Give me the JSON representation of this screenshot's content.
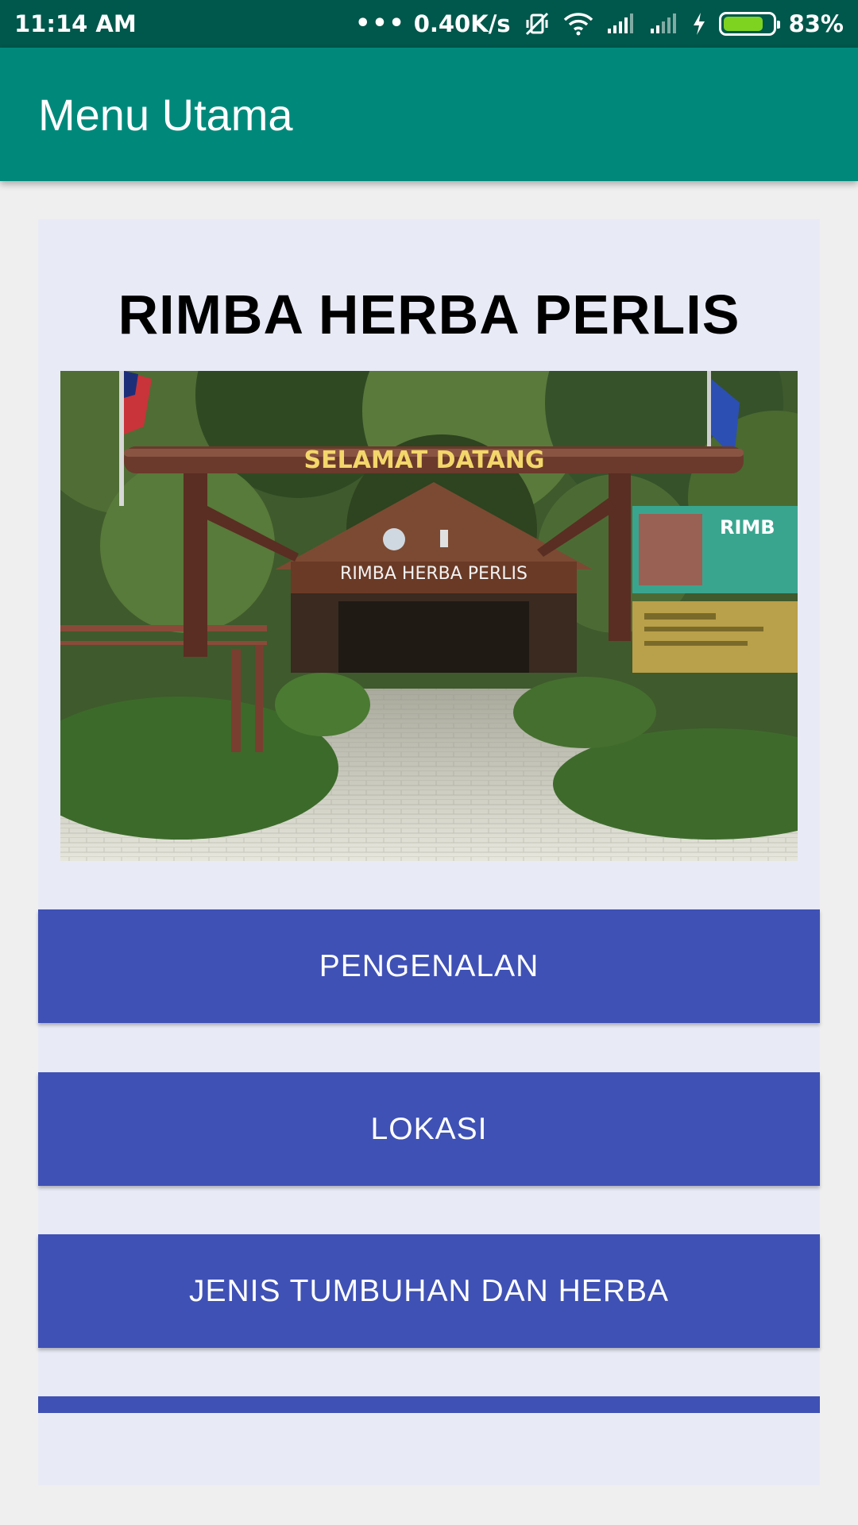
{
  "status_bar": {
    "time": "11:14 AM",
    "network_speed": "0.40K/s",
    "battery_level": 83,
    "battery_text": "83%",
    "icons": [
      "more-dots-icon",
      "vibrate-off-icon",
      "wifi-icon",
      "signal-icon",
      "signal-icon",
      "charging-bolt-icon",
      "battery-icon"
    ]
  },
  "appbar": {
    "title": "Menu Utama"
  },
  "main": {
    "heading": "RIMBA HERBA PERLIS",
    "photo": {
      "arch_text": "SELAMAT DATANG",
      "sign_text": "RIMBA HERBA PERLIS",
      "board_text": "RIMB"
    },
    "buttons": [
      {
        "label": "PENGENALAN"
      },
      {
        "label": "LOKASI"
      },
      {
        "label": "JENIS TUMBUHAN DAN HERBA"
      }
    ]
  },
  "colors": {
    "status_bar": "#00574b",
    "app_bar": "#00897b",
    "card": "#e8eaf6",
    "button": "#3f51b5"
  }
}
